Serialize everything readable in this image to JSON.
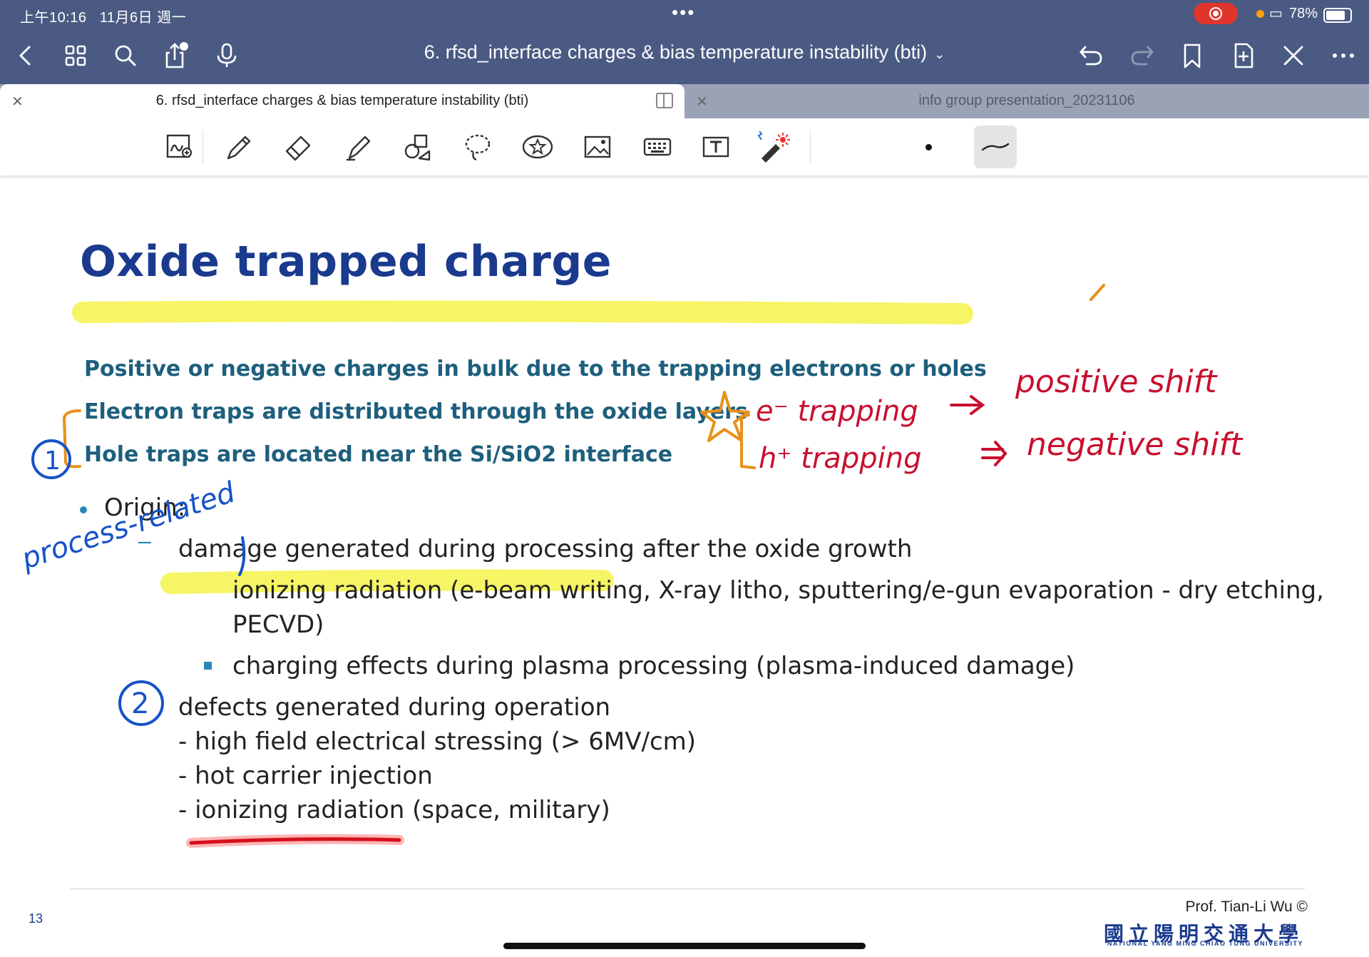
{
  "status_bar": {
    "time": "上午10:16",
    "date": "11月6日 週一",
    "battery": "78%"
  },
  "nav": {
    "title": "6. rfsd_interface charges & bias temperature instability (bti)"
  },
  "tabs": [
    {
      "label": "6. rfsd_interface charges & bias temperature instability (bti)",
      "active": true
    },
    {
      "label": "info group presentation_20231106",
      "active": false
    }
  ],
  "toolbar": {
    "tools": [
      "lasso-zoom-icon",
      "pen-icon",
      "eraser-icon",
      "highlighter-icon",
      "shapes-icon",
      "lasso-icon",
      "sticker-icon",
      "image-icon",
      "keyboard-icon",
      "text-box-icon",
      "laser-pointer-icon"
    ]
  },
  "slide": {
    "title": "Oxide trapped charge",
    "line1": "Positive or negative charges in bulk due to the trapping electrons or holes",
    "line2": "Electron traps are distributed through the oxide layers",
    "line3": "Hole traps are located near the Si/SiO2 interface",
    "origin": "Origin:",
    "item1": "damage generated during processing after the oxide growth",
    "sub1a": "ionizing radiation (e-beam writing, X-ray litho, sputtering/e-gun evaporation - dry etching,",
    "sub1b": "PECVD)",
    "sub2": "charging effects during plasma processing (plasma-induced damage)",
    "item2": "defects generated during operation",
    "op1": "- high field electrical stressing (> 6MV/cm)",
    "op2": "- hot carrier injection",
    "op3": "- ionizing radiation (space, military)",
    "page": "13",
    "credit": "Prof. Tian-Li Wu ©",
    "univ_cn": "國立陽明交通大學",
    "univ_en": "NATIONAL YANG MING CHIAO TUNG UNIVERSITY"
  },
  "annotations": {
    "e_trap": "e⁻ trapping",
    "pos_shift": "positive shift",
    "h_trap": "h⁺ trapping",
    "neg_shift": "negative shift",
    "circle1": "1",
    "circle2": "2",
    "process_related": "process-related",
    "colors": {
      "red": "#c8102e",
      "blue": "#1652c8",
      "orange": "#e8901a",
      "highlight": "#f4f34a"
    }
  }
}
